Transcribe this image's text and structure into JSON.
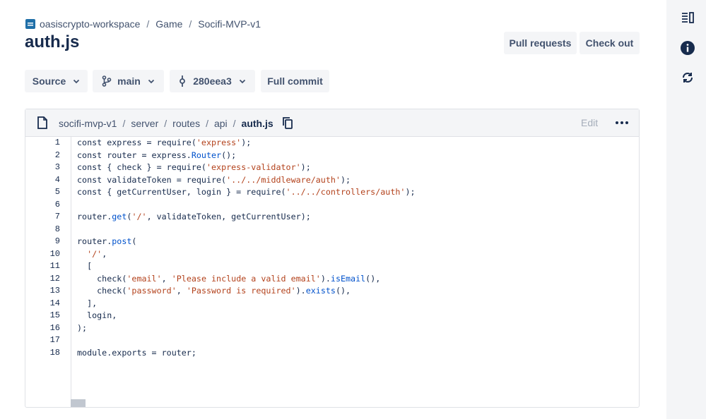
{
  "breadcrumb": {
    "workspace": "oasiscrypto-workspace",
    "project": "Game",
    "repo": "Socifi-MVP-v1",
    "separator": "/"
  },
  "page_title": "auth.js",
  "header_buttons": {
    "pull_requests": "Pull requests",
    "check_out": "Check out"
  },
  "toolbar": {
    "source": "Source",
    "branch": "main",
    "commit": "280eea3",
    "full_commit": "Full commit"
  },
  "file_path": {
    "segments": [
      "socifi-mvp-v1",
      "server",
      "routes",
      "api"
    ],
    "current": "auth.js",
    "separator": "/"
  },
  "file_actions": {
    "edit": "Edit",
    "more": "•••"
  },
  "code_lines": [
    "const express = require('express');",
    "const router = express.Router();",
    "const { check } = require('express-validator');",
    "const validateToken = require('../../middleware/auth');",
    "const { getCurrentUser, login } = require('../../controllers/auth');",
    "",
    "router.get('/', validateToken, getCurrentUser);",
    "",
    "router.post(",
    "  '/',",
    "  [",
    "    check('email', 'Please include a valid email').isEmail(),",
    "    check('password', 'Password is required').exists(),",
    "  ],",
    "  login,",
    ");",
    "",
    "module.exports = router;"
  ],
  "line_numbers": [
    "1",
    "2",
    "3",
    "4",
    "5",
    "6",
    "7",
    "8",
    "9",
    "10",
    "11",
    "12",
    "13",
    "14",
    "15",
    "16",
    "17",
    "18"
  ],
  "icons": {
    "sidebar_toggle": "panel-toggle-icon",
    "info": "info-icon",
    "sync": "sync-icon",
    "file": "file-icon",
    "copy": "copy-icon",
    "branch": "branch-icon",
    "commit": "commit-icon",
    "workspace": "workspace-icon"
  },
  "colors": {
    "string": "#b3421c",
    "method": "#0052cc",
    "text": "#172b4d",
    "muted": "#42526e",
    "panel_bg": "#f4f5f7"
  }
}
